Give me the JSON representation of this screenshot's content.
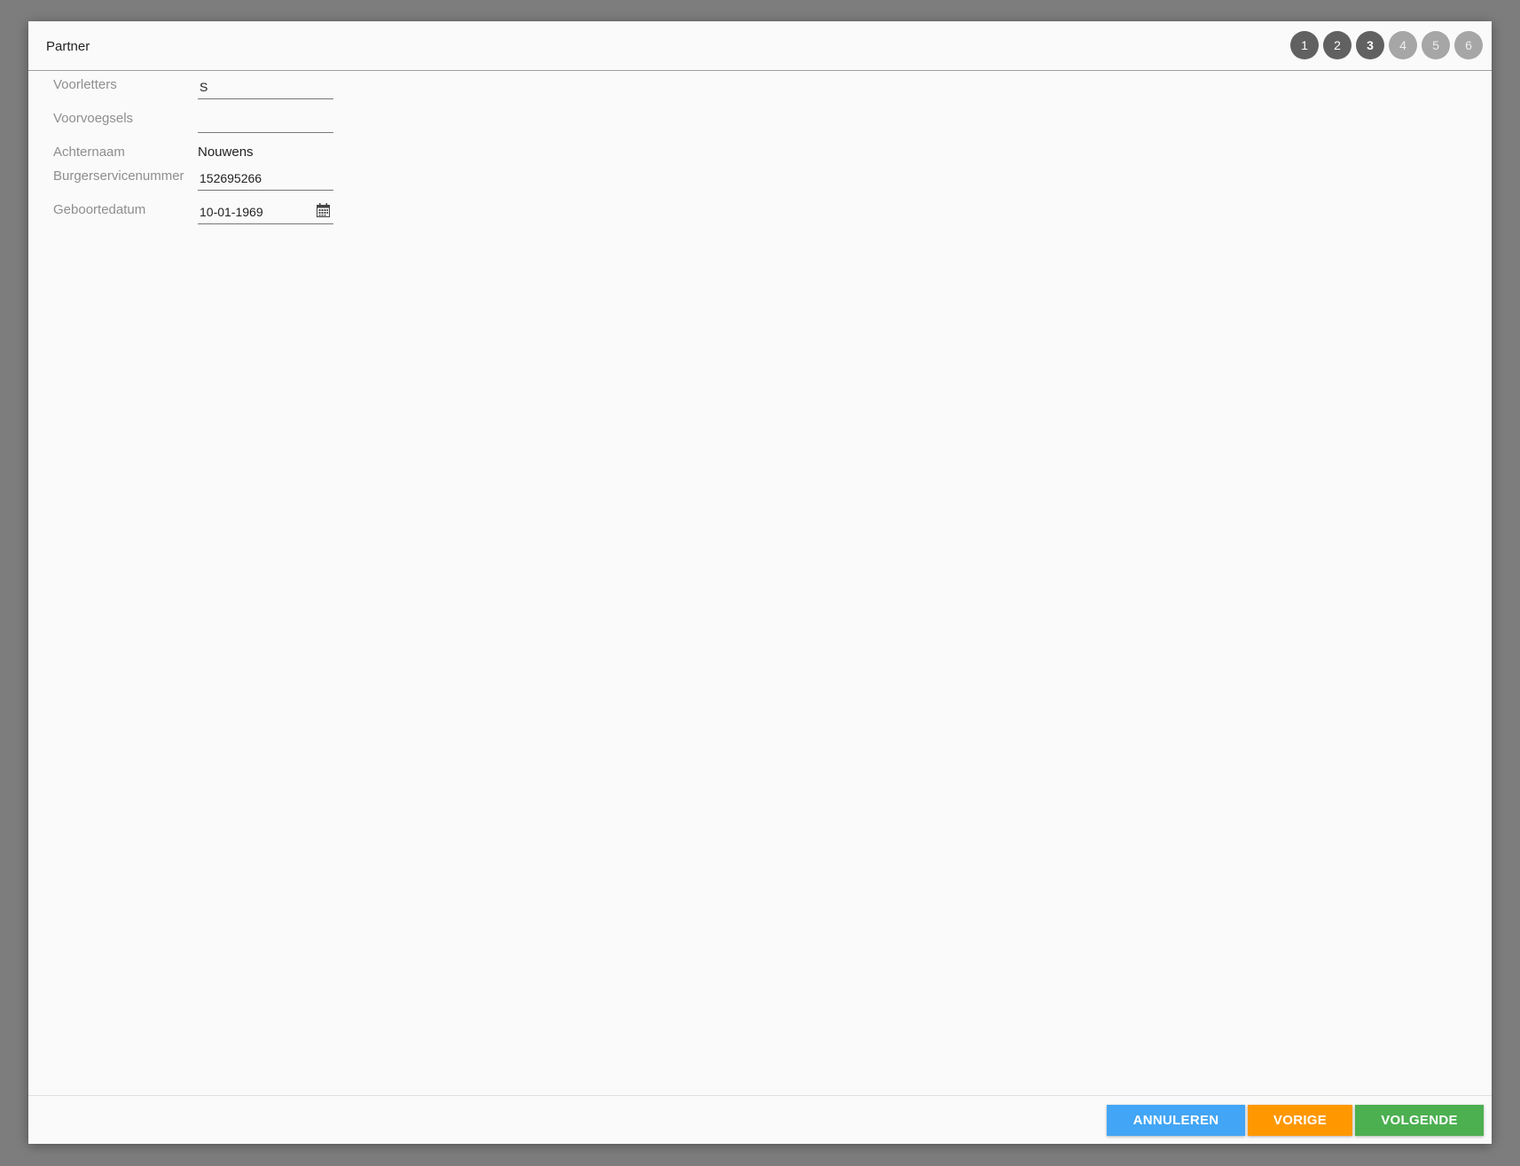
{
  "dialog": {
    "title": "Partner",
    "steps": [
      {
        "label": "1",
        "state": "done"
      },
      {
        "label": "2",
        "state": "done"
      },
      {
        "label": "3",
        "state": "active"
      },
      {
        "label": "4",
        "state": "todo"
      },
      {
        "label": "5",
        "state": "todo"
      },
      {
        "label": "6",
        "state": "todo"
      }
    ]
  },
  "form": {
    "initials": {
      "label": "Voorletters",
      "value": "S"
    },
    "prefixes": {
      "label": "Voorvoegsels",
      "value": ""
    },
    "surname": {
      "label": "Achternaam",
      "value": "Nouwens"
    },
    "bsn": {
      "label": "Burgerservicenummer",
      "value": "152695266"
    },
    "birthdate": {
      "label": "Geboortedatum",
      "value": "10-01-1969",
      "icon": "calendar-icon"
    }
  },
  "footer": {
    "cancel_label": "ANNULEREN",
    "prev_label": "VORIGE",
    "next_label": "VOLGENDE"
  },
  "colors": {
    "cancel": "#42a5f5",
    "prev": "#ff9800",
    "next": "#4caf50",
    "step_done": "#616161",
    "step_todo": "#a6a6a6"
  }
}
